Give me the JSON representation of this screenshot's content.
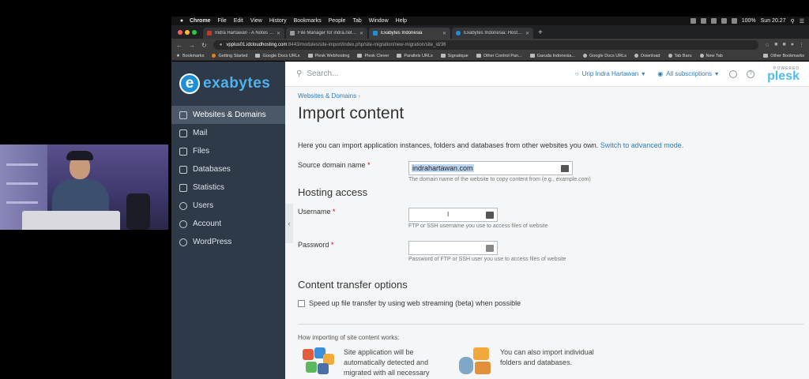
{
  "macbar": {
    "app": "Chrome",
    "menus": [
      "File",
      "Edit",
      "View",
      "History",
      "Bookmarks",
      "People",
      "Tab",
      "Window",
      "Help"
    ],
    "battery": "100%",
    "clock": "Sun 20.27"
  },
  "tabs": [
    {
      "title": "Indra Hartawan - A Notes to m",
      "active": false
    },
    {
      "title": "File Manager for indra.net/m",
      "active": false
    },
    {
      "title": "Exabytes Indonesia",
      "active": true
    },
    {
      "title": "Exabytes Indonesia: Hosting, S",
      "active": false
    }
  ],
  "address": {
    "host": "vpplus01.idcloudhosting.com",
    "path": ":8443/modules/site-import/index.php/site-migration/new-migration/site_id/36"
  },
  "bookmarks": [
    "Bookmarks",
    "Getting Started",
    "Google Docs URLs",
    "Plesk Webhosting",
    "Plesk Clever",
    "Parallels URLs",
    "Signatique",
    "Other Control Pan...",
    "Garuda Indonesia...",
    "Google Docs URLs",
    "Download",
    "Tab Baru",
    "New Tab",
    "Other Bookmarks"
  ],
  "brand": {
    "logo_letter": "e",
    "logo_text": "exabytes"
  },
  "sidebar": {
    "items": [
      {
        "label": "Websites & Domains",
        "icon": "monitor-icon",
        "active": true
      },
      {
        "label": "Mail",
        "icon": "mail-icon",
        "active": false
      },
      {
        "label": "Files",
        "icon": "folder-icon",
        "active": false
      },
      {
        "label": "Databases",
        "icon": "database-icon",
        "active": false
      },
      {
        "label": "Statistics",
        "icon": "chart-icon",
        "active": false
      },
      {
        "label": "Users",
        "icon": "users-icon",
        "active": false
      },
      {
        "label": "Account",
        "icon": "account-icon",
        "active": false
      },
      {
        "label": "WordPress",
        "icon": "wordpress-icon",
        "active": false
      }
    ]
  },
  "topbar": {
    "search_placeholder": "Search...",
    "user": "Urip Indra Hartawan",
    "subscriptions": "All subscriptions",
    "powered": "POWERED",
    "plesk": "plesk"
  },
  "page": {
    "breadcrumb": "Websites & Domains",
    "title": "Import content",
    "intro": "Here you can import application instances, folders and databases from other websites you own.",
    "intro_link": "Switch to advanced mode.",
    "source_label": "Source domain name",
    "source_value": "indrahartawan.com",
    "source_hint": "The domain name of the website to copy content from (e.g., example.com)",
    "hosting_heading": "Hosting access",
    "username_label": "Username",
    "username_hint": "FTP or SSH username you use to access files of website",
    "password_label": "Password",
    "password_hint": "Password of FTP or SSH user you use to access files of website",
    "transfer_heading": "Content transfer options",
    "stream_label": "Speed up file transfer by using web streaming (beta) when possible",
    "howto_heading": "How importing of site content works:",
    "how1": "Site application will be automatically detected and migrated with all necessary",
    "how2": "You can also import individual folders and databases."
  }
}
